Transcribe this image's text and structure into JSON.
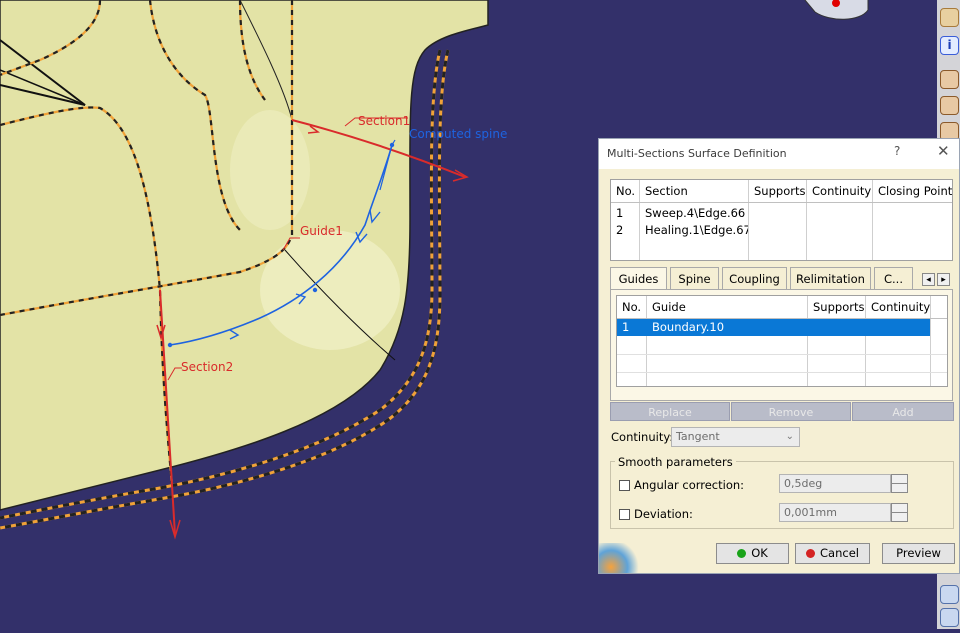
{
  "viewport": {
    "labels": {
      "section1": "Section1",
      "computed_spine": "Computed spine",
      "guide1": "Guide1",
      "section2": "Section2"
    },
    "colors": {
      "background": "#33306a",
      "surface": "#e3e3a6",
      "section_red": "#d92b2b",
      "spine_blue": "#1e63e0",
      "guide_orange": "#f0a238"
    }
  },
  "toolbar": {
    "icons": [
      "info-icon",
      "user-icon",
      "user-icon",
      "user-icon",
      "user-icon"
    ]
  },
  "dialog": {
    "title": "Multi-Sections Surface Definition",
    "help": "?",
    "close": "✕",
    "sections_table": {
      "columns": [
        "No.",
        "Section",
        "Supports",
        "Continuity",
        "Closing Point"
      ],
      "rows": [
        [
          "1",
          "Sweep.4\\Edge.66",
          "",
          "",
          ""
        ],
        [
          "2",
          "Healing.1\\Edge.67",
          "",
          "",
          ""
        ]
      ]
    },
    "tabs": [
      "Guides",
      "Spine",
      "Coupling",
      "Relimitation",
      "C..."
    ],
    "active_tab": "Guides",
    "guides_table": {
      "columns": [
        "No.",
        "Guide",
        "Supports",
        "Continuity"
      ],
      "rows": [
        [
          "1",
          "Boundary.10",
          "",
          ""
        ]
      ],
      "selected_row": 0
    },
    "list_buttons": {
      "replace": "Replace",
      "remove": "Remove",
      "add": "Add"
    },
    "continuity": {
      "label": "Continuity:",
      "value": "Tangent"
    },
    "smooth": {
      "title": "Smooth parameters",
      "angular_label": "Angular correction:",
      "angular_value": "0,5deg",
      "angular_checked": false,
      "deviation_label": "Deviation:",
      "deviation_value": "0,001mm",
      "deviation_checked": false
    },
    "buttons": {
      "ok": "OK",
      "cancel": "Cancel",
      "preview": "Preview"
    }
  }
}
